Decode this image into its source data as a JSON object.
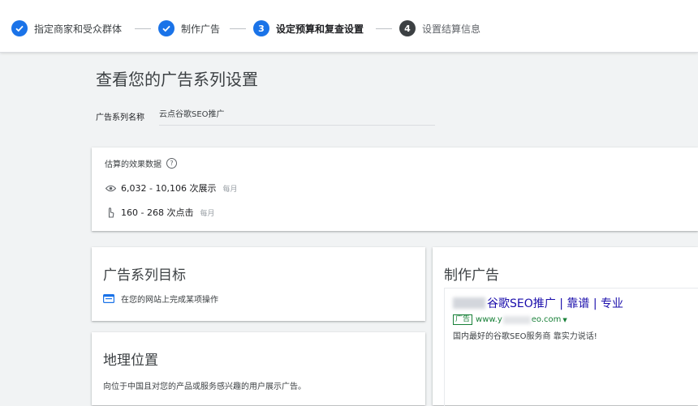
{
  "stepper": {
    "steps": [
      {
        "label": "指定商家和受众群体",
        "state": "done"
      },
      {
        "label": "制作广告",
        "state": "done"
      },
      {
        "label": "设定预算和复查设置",
        "state": "active",
        "number": "3"
      },
      {
        "label": "设置结算信息",
        "state": "todo",
        "number": "4"
      }
    ]
  },
  "page": {
    "title": "查看您的广告系列设置",
    "campaign_name_label": "广告系列名称",
    "campaign_name_value": "云点谷歌SEO推广"
  },
  "estimate": {
    "title": "估算的效果数据",
    "impressions": "6,032 - 10,106 次展示",
    "impressions_period": "每月",
    "clicks": "160 - 268 次点击",
    "clicks_period": "每月"
  },
  "goal": {
    "title": "广告系列目标",
    "item": "在您的网站上完成某项操作"
  },
  "geo": {
    "title": "地理位置",
    "text": "向位于中国且对您的产品或服务感兴趣的用户展示广告。"
  },
  "ad": {
    "title": "制作广告",
    "headline": "谷歌SEO推广 | 靠谱 | 专业",
    "badge": "广告",
    "url_prefix": "www.y",
    "url_suffix": "eo.com",
    "description": "国内最好的谷歌SEO服务商 靠实力说话!"
  },
  "colors": {
    "accent": "#1a73e8",
    "link": "#1a0dab",
    "url": "#188038"
  }
}
